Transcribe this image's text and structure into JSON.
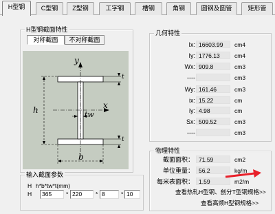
{
  "tabs": [
    {
      "label": "H型钢",
      "active": true
    },
    {
      "label": "C型钢",
      "active": false
    },
    {
      "label": "Z型钢",
      "active": false
    },
    {
      "label": "工字钢",
      "active": false
    },
    {
      "label": "槽钢",
      "active": false
    },
    {
      "label": "角钢",
      "active": false
    },
    {
      "label": "圆钢及圆管",
      "active": false
    },
    {
      "label": "矩形管",
      "active": false
    }
  ],
  "section": {
    "title": "H型钢截面特性",
    "subtabs": [
      "对称截面",
      "不对称截面"
    ],
    "diagram_labels": {
      "y": "y",
      "x": "x",
      "tw": "tw",
      "h": "h",
      "b": "b",
      "t": "t"
    }
  },
  "geometry": {
    "title": "几何特性",
    "rows": [
      {
        "label": "Ix:",
        "value": "16603.99",
        "unit": "cm4"
      },
      {
        "label": "Iy:",
        "value": "1776.13",
        "unit": "cm4"
      },
      {
        "label": "Wx:",
        "value": "909.8",
        "unit": "cm3"
      },
      {
        "label": "----",
        "value": "",
        "unit": "cm3"
      },
      {
        "label": "Wy:",
        "value": "161.46",
        "unit": "cm3"
      },
      {
        "label": "ix:",
        "value": "15.22",
        "unit": "cm"
      },
      {
        "label": "iy:",
        "value": "4.98",
        "unit": "cm"
      },
      {
        "label": "Sx:",
        "value": "509.52",
        "unit": "cm3"
      },
      {
        "label": "----",
        "value": "",
        "unit": "cm3"
      }
    ]
  },
  "physical": {
    "title": "物理特性",
    "rows": [
      {
        "label": "截面面积：",
        "value": "71.59",
        "unit": "cm2"
      },
      {
        "label": "单位重量：",
        "value": "56.2",
        "unit": "kg/m"
      },
      {
        "label": "每米表面积：",
        "value": "1.59",
        "unit": "m2/m"
      }
    ],
    "link1": "查看热轧H型钢、剖分T型钢规格>>",
    "link2": "查看高频H型钢规格>>"
  },
  "input": {
    "title": "输入截面参数",
    "format_label": "H",
    "format_text": "h*b*tw*t(mm)",
    "row_label": "H",
    "h": "365",
    "b": "220",
    "tw": "8",
    "t": "10",
    "sep": "*"
  },
  "colors": {
    "arrow": "#e8202a",
    "diagram_bg": "#c5ccc1"
  }
}
